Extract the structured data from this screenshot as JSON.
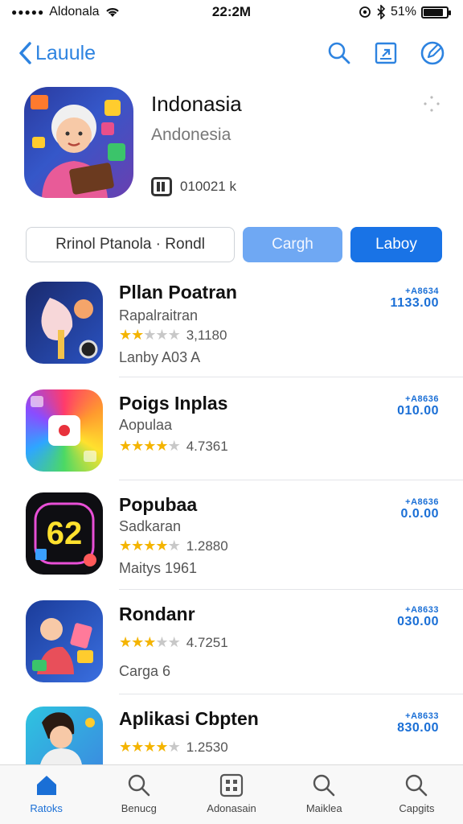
{
  "status_bar": {
    "carrier": "Aldonala",
    "time": "22:2M",
    "battery": "51%",
    "battery_level": 0.85
  },
  "nav": {
    "back_label": "Lauule",
    "icons": [
      "search-icon",
      "share-icon",
      "compose-icon"
    ]
  },
  "hero": {
    "title": "Indonasia",
    "subtitle": "Andonesia",
    "meta": "010021 k"
  },
  "segments": {
    "first": "Rrinol Ptanola · Rondl",
    "second": "Cargh",
    "third": "Laboy"
  },
  "apps": [
    {
      "name": "Pllan Poatran",
      "subtitle": "Rapalraitran",
      "rating_count": "3,1180",
      "rating_value": 2.5,
      "extra": "Lanby A03 A",
      "price_top": "+A8634",
      "price_main": "1133.00"
    },
    {
      "name": "Poigs Inplas",
      "subtitle": "Aopulaa",
      "rating_count": "4.7361",
      "rating_value": 4.5,
      "extra": "",
      "price_top": "+A8636",
      "price_main": "010.00"
    },
    {
      "name": "Popubaa",
      "subtitle": "Sadkaran",
      "rating_count": "1.2880",
      "rating_value": 4.5,
      "extra": "Maitys 1961",
      "price_top": "+A8636",
      "price_main": "0.0.00"
    },
    {
      "name": "Rondanr",
      "subtitle": "",
      "rating_count": "4.7251",
      "rating_value": 3.5,
      "extra": "Carga 6",
      "price_top": "+A8633",
      "price_main": "030.00"
    },
    {
      "name": "Aplikasi Cbpten",
      "subtitle": "",
      "rating_count": "1.2530",
      "rating_value": 4.5,
      "extra": "",
      "price_top": "+A8633",
      "price_main": "830.00"
    }
  ],
  "tabs": [
    {
      "label": "Ratoks",
      "icon": "home-icon",
      "active": true
    },
    {
      "label": "Benucg",
      "icon": "search-icon",
      "active": false
    },
    {
      "label": "Adonasain",
      "icon": "grid-icon",
      "active": false
    },
    {
      "label": "Maiklea",
      "icon": "search-icon",
      "active": false
    },
    {
      "label": "Capgits",
      "icon": "search-icon",
      "active": false
    }
  ],
  "colors": {
    "accent": "#1a6fd6",
    "accent_light": "#6fa8f3",
    "star": "#f4b400"
  }
}
